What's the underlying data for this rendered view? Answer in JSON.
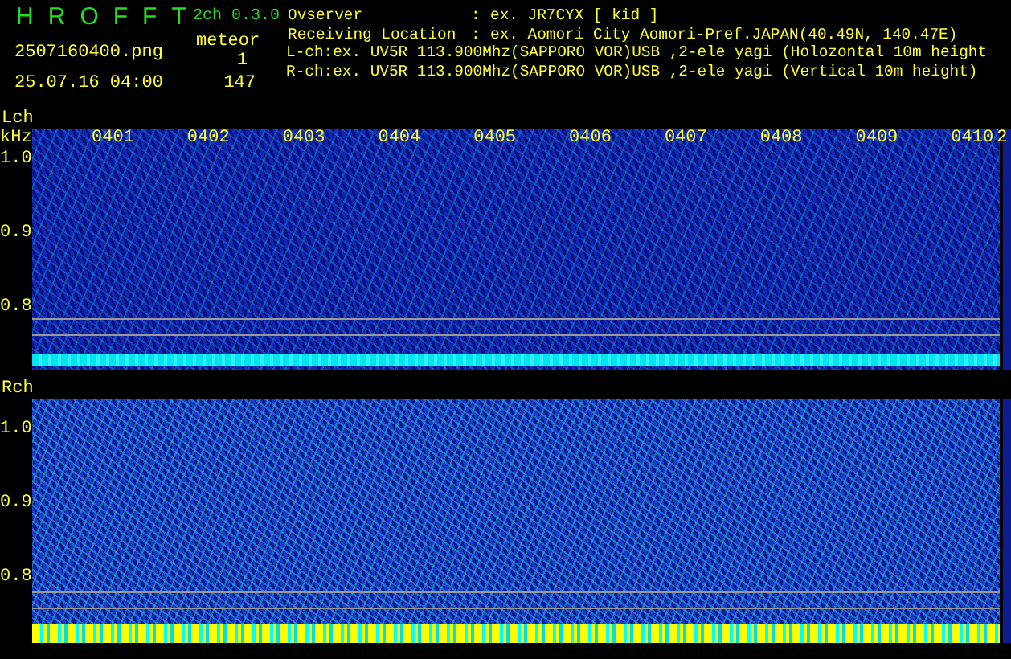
{
  "app": {
    "title_letters": [
      "H",
      "R",
      "O",
      "F",
      "F",
      "T"
    ],
    "version": "2ch 0.3.0",
    "file": "2507160400.png",
    "timestamp": "25.07.16 04:00",
    "meteor_label": "meteor",
    "meteor_counts": [
      "1",
      "147"
    ]
  },
  "info": [
    {
      "kind": "field",
      "label": "Ovserver",
      "separator": ":",
      "value": "ex. JR7CYX [ kid ]"
    },
    {
      "kind": "field",
      "label": "Receiving Location",
      "separator": ":",
      "value": "ex. Aomori City Aomori-Pref.JAPAN(40.49N, 140.47E)"
    },
    {
      "kind": "line",
      "text": "L-ch:ex. UV5R 113.900Mhz(SAPPORO VOR)USB ,2-ele yagi (Holozontal 10m height"
    },
    {
      "kind": "line",
      "text": "R-ch:ex. UV5R 113.900Mhz(SAPPORO VOR)USB ,2-ele yagi (Vertical 10m height)"
    }
  ],
  "channels": [
    {
      "name": "Lch",
      "unit": "kHz",
      "times": [
        "0401",
        "0402",
        "0403",
        "0404",
        "0405",
        "0406",
        "0407",
        "0408",
        "0409",
        "0410",
        "2"
      ],
      "y_labels": [
        "1.0",
        "0.9",
        "0.8"
      ]
    },
    {
      "name": "Rch",
      "y_labels": [
        "1.0",
        "0.9",
        "0.8"
      ]
    }
  ]
}
